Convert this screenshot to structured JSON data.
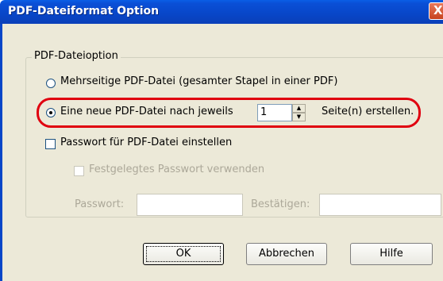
{
  "window": {
    "title": "PDF-Dateiformat Option",
    "close_glyph": "X"
  },
  "group": {
    "legend": "PDF-Dateioption"
  },
  "options": {
    "multipage_label": "Mehrseitige PDF-Datei (gesamter Stapel in einer PDF)",
    "new_file_label": "Eine neue PDF-Datei nach jeweils",
    "pages_value": "1",
    "pages_suffix": "Seite(n) erstellen.",
    "password_label": "Passwort für PDF-Datei einstellen",
    "fixed_password_label": "Festgelegtes Passwort verwenden",
    "password_field_label": "Passwort:",
    "confirm_field_label": "Bestätigen:"
  },
  "buttons": {
    "ok": "OK",
    "cancel": "Abbrechen",
    "help": "Hilfe"
  },
  "icons": {
    "spin_up": "▲",
    "spin_down": "▼"
  },
  "colors": {
    "titlebar": "#0846c8",
    "highlight": "#e0000f",
    "dialog_bg": "#ece9d8"
  }
}
